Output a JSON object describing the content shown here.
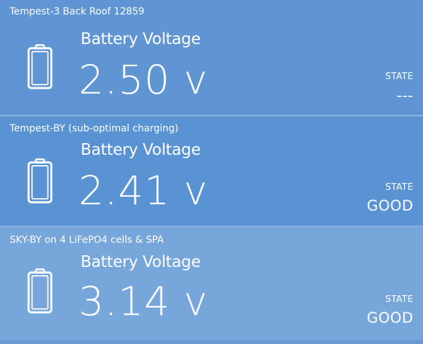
{
  "tiles": [
    {
      "title": "Tempest-3 Back Roof 12859",
      "metric_label": "Battery Voltage",
      "value": "2.50 v",
      "state_label": "STATE",
      "state_value": "---",
      "bg": "#5f95d2"
    },
    {
      "title": "Tempest-BY (sub-optimal charging)",
      "metric_label": "Battery Voltage",
      "value": "2.41 v",
      "state_label": "STATE",
      "state_value": "GOOD",
      "bg": "#5a93d3"
    },
    {
      "title": "SKY-BY on 4 LiFePO4 cells & SPA",
      "metric_label": "Battery Voltage",
      "value": "3.14 v",
      "state_label": "STATE",
      "state_value": "GOOD",
      "bg": "#77a6da"
    }
  ],
  "icons": {
    "battery": "battery-icon"
  }
}
